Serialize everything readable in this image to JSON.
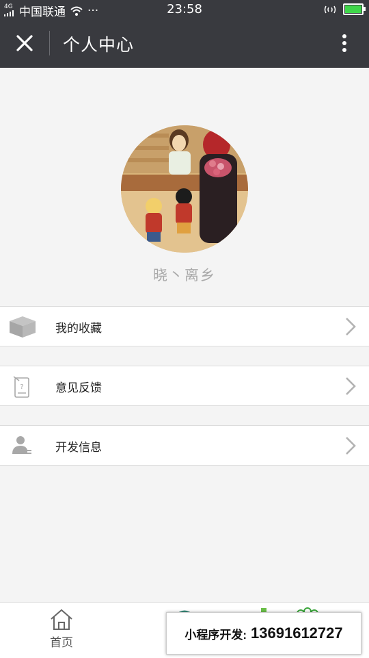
{
  "status_bar": {
    "signal_label": "4G",
    "carrier": "中国联通",
    "more_dots": "···",
    "time": "23:58"
  },
  "nav": {
    "title": "个人中心",
    "close_icon": "close-icon",
    "more_icon": "more-vertical-icon"
  },
  "profile": {
    "nickname": "晓丶离乡"
  },
  "menu": [
    {
      "label": "我的收藏",
      "icon": "box-icon"
    },
    {
      "label": "意见反馈",
      "icon": "feedback-icon"
    },
    {
      "label": "开发信息",
      "icon": "user-info-icon"
    }
  ],
  "tabbar": {
    "home_label": "首页",
    "home_icon": "home-icon"
  },
  "ad_overlay": {
    "label": "小程序开发:",
    "phone": "13691612727"
  },
  "colors": {
    "nav_bg": "#393a3f",
    "page_bg": "#f4f4f4",
    "nickname": "#a9a9a9",
    "battery": "#3fd64a"
  }
}
